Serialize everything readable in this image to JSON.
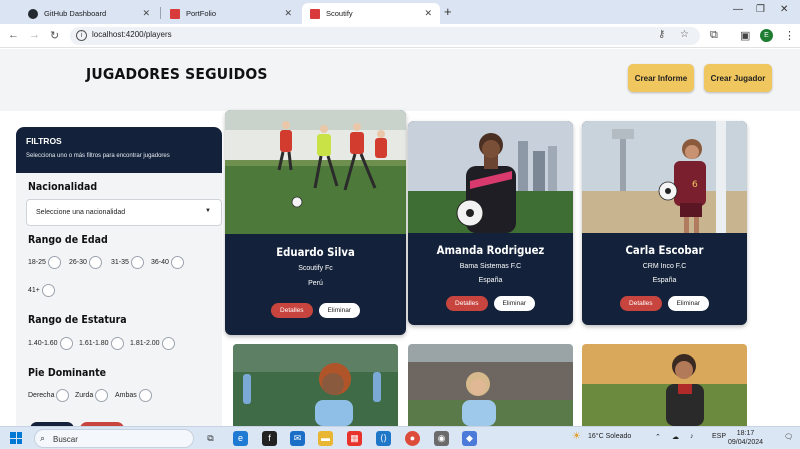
{
  "browser": {
    "tabs": [
      {
        "title": "GitHub Dashboard",
        "favicon_color": "#24292f",
        "active": false
      },
      {
        "title": "PortFolio",
        "favicon_color": "#d93a3a",
        "active": false
      },
      {
        "title": "Scoutify",
        "favicon_color": "#d93a3a",
        "active": true
      }
    ],
    "url": "localhost:4200/players",
    "profile_initial": "E"
  },
  "header": {
    "title": "JUGADORES SEGUIDOS",
    "buttons": [
      "Crear Informe",
      "Crear Jugador"
    ],
    "button_color": "#f0c75e"
  },
  "filters": {
    "title": "FILTROS",
    "subtitle": "Selecciona uno o más filtros para encontrar jugadores",
    "nationality": {
      "label": "Nacionalidad",
      "placeholder": "Seleccione una nacionalidad"
    },
    "age": {
      "label": "Rango de Edad",
      "options": [
        "18-25",
        "26-30",
        "31-35",
        "36-40",
        "41+"
      ]
    },
    "height": {
      "label": "Rango de Estatura",
      "options": [
        "1.40-1.60",
        "1.61-1.80",
        "1.81-2.00"
      ]
    },
    "foot": {
      "label": "Pie Dominante",
      "options": [
        "Derecha",
        "Zurda",
        "Ambas"
      ]
    }
  },
  "players": [
    {
      "name": "Eduardo Silva",
      "club": "Scoutify Fc",
      "country": "Perú"
    },
    {
      "name": "Amanda Rodriguez",
      "club": "Bama Sistemas F.C",
      "country": "España"
    },
    {
      "name": "Carla Escobar",
      "club": "CRM Inco F.C",
      "country": "España"
    }
  ],
  "card_buttons": {
    "details": "Detalles",
    "delete": "Eliminar"
  },
  "colors": {
    "navy": "#13223a",
    "danger": "#c8453f",
    "accent": "#f0c75e"
  },
  "taskbar": {
    "search_placeholder": "Buscar",
    "weather": "16°C  Soleado",
    "language": "ESP",
    "time": "18:17",
    "date": "09/04/2024"
  }
}
